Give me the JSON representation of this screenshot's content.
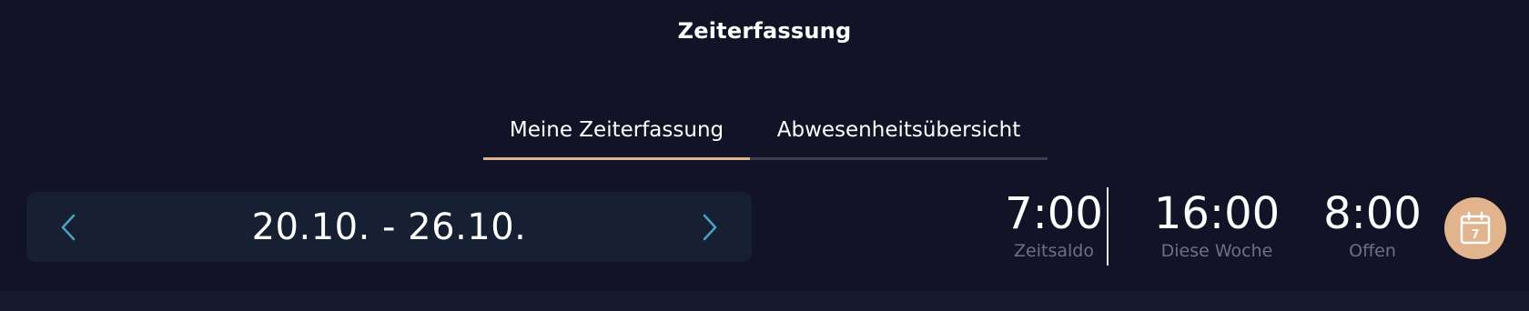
{
  "header": {
    "title": "Zeiterfassung"
  },
  "tabs": [
    {
      "label": "Meine Zeiterfassung",
      "active": true
    },
    {
      "label": "Abwesenheitsübersicht",
      "active": false
    }
  ],
  "week_nav": {
    "range": "20.10. - 26.10.",
    "prev_icon": "chevron-left-icon",
    "next_icon": "chevron-right-icon"
  },
  "stats": [
    {
      "value": "7:00",
      "label": "Zeitsaldo"
    },
    {
      "value": "16:00",
      "label": "Diese Woche"
    },
    {
      "value": "8:00",
      "label": "Offen"
    }
  ],
  "calendar_button": {
    "icon": "calendar-icon",
    "day": "7"
  },
  "colors": {
    "background": "#121326",
    "accent": "#e2b48e",
    "nav_background": "#171f33",
    "chevron": "#4aa3c4",
    "muted_text": "#6c7084"
  }
}
